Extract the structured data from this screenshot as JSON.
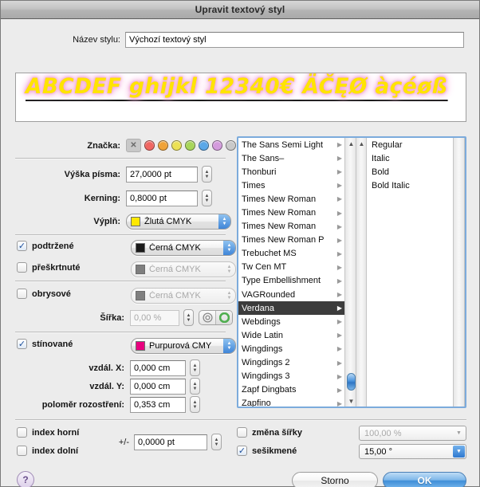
{
  "window": {
    "title": "Upravit textový styl"
  },
  "name_field": {
    "label": "Název stylu:",
    "value": "Výchozí textový styl"
  },
  "preview": {
    "text": "ABCDEF ghijkl 12340€ ÄČĘØ àçéøß",
    "text_color": "#ffe400",
    "shadow_color": "#ef9ed0",
    "underline_color": "#191919"
  },
  "marker": {
    "label": "Značka:",
    "none_glyph": "✕",
    "colors": [
      "#f06662",
      "#f0a338",
      "#ece154",
      "#a8d65a",
      "#5aa8e8",
      "#d49bdd",
      "#c9c9c9"
    ],
    "selected_index": -1
  },
  "font_size": {
    "label": "Výška písma:",
    "value": "27,0000 pt"
  },
  "kerning": {
    "label": "Kerning:",
    "value": "0,8000 pt"
  },
  "fill": {
    "label": "Výplň:",
    "value": "Žlutá CMYK",
    "swatch": "#ffe800",
    "enabled": true
  },
  "underline": {
    "label": "podtržené",
    "checked": true,
    "color_value": "Černá CMYK",
    "swatch": "#1a1a1a",
    "enabled": true
  },
  "strikethrough": {
    "label": "přeškrtnuté",
    "checked": false,
    "color_value": "Černá CMYK",
    "swatch": "#7f7f7f",
    "enabled": false
  },
  "outline": {
    "label": "obrysové",
    "checked": false,
    "color_value": "Černá CMYK",
    "swatch": "#7f7f7f",
    "enabled": false
  },
  "outline_width": {
    "label": "Šířka:",
    "value": "0,00 %",
    "enabled": false,
    "toggle_left": "concentric-circles-icon",
    "toggle_right": "filled-circle-icon",
    "toggle_selected": "right",
    "toggle_color": "#5fc05f"
  },
  "shadow": {
    "label": "stínované",
    "checked": true,
    "color_value": "Purpurová CMY",
    "swatch": "#e8007f",
    "enabled": true
  },
  "shadow_x": {
    "label": "vzdál. X:",
    "value": "0,000 cm"
  },
  "shadow_y": {
    "label": "vzdál. Y:",
    "value": "0,000 cm"
  },
  "shadow_blur": {
    "label": "poloměr rozostření:",
    "value": "0,353 cm"
  },
  "font_list": {
    "items": [
      "The Sans Semi Light",
      "The Sans–",
      "Thonburi",
      "Times",
      "Times New Roman",
      "Times New Roman",
      "Times New Roman",
      "Times New Roman P",
      "Trebuchet MS",
      "Tw Cen MT",
      "Type Embellishment",
      "VAGRounded",
      "Verdana",
      "Webdings",
      "Wide Latin",
      "Wingdings",
      "Wingdings 2",
      "Wingdings 3",
      "Zapf Dingbats",
      "Zapfino"
    ],
    "selected": "Verdana",
    "selected_index": 12,
    "submenu_glyph": "▶"
  },
  "style_list": {
    "items": [
      "Regular",
      "Italic",
      "Bold",
      "Bold Italic"
    ],
    "selected_index": -1
  },
  "superscript": {
    "label": "index horní",
    "checked": false
  },
  "subscript": {
    "label": "index dolní",
    "checked": false
  },
  "offset": {
    "label": "+/-",
    "value": "0,0000 pt"
  },
  "width_change": {
    "label": "změna šířky",
    "checked": false,
    "value": "100,00 %",
    "enabled": false
  },
  "skew": {
    "label": "sešikmené",
    "checked": true,
    "value": "15,00 °",
    "enabled": true
  },
  "footer": {
    "help": "?",
    "cancel": "Storno",
    "ok": "OK"
  }
}
